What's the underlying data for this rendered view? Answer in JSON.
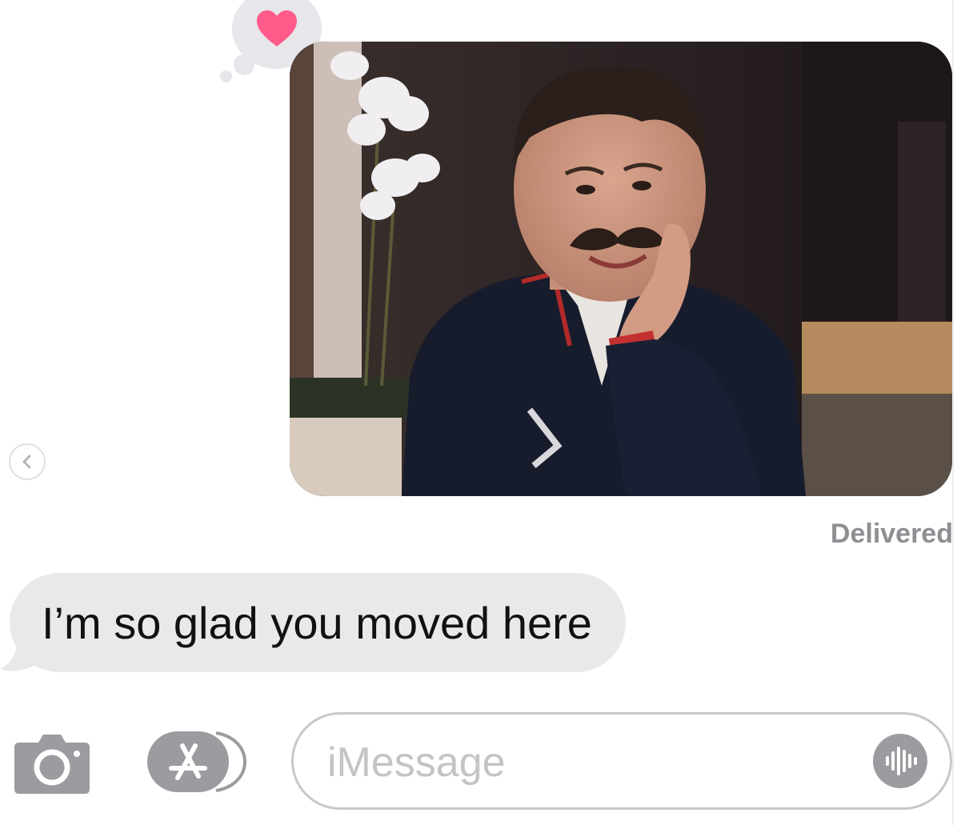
{
  "thread": {
    "tapback": {
      "icon": "heart-icon",
      "color": "#ff5a8a"
    },
    "photo_message": {
      "alt": "photo-attachment"
    },
    "delivered_label": "Delivered",
    "incoming_message": "I’m so glad you moved here"
  },
  "composer": {
    "camera_icon": "camera-icon",
    "apps_icon": "app-store-icon",
    "placeholder": "iMessage",
    "audio_icon": "audio-waveform-icon"
  },
  "nav": {
    "back_icon": "chevron-left-icon"
  },
  "colors": {
    "incoming_bubble": "#e9e9eb",
    "meta_text": "#8e8e93",
    "icon_gray": "#9b9ba0"
  }
}
